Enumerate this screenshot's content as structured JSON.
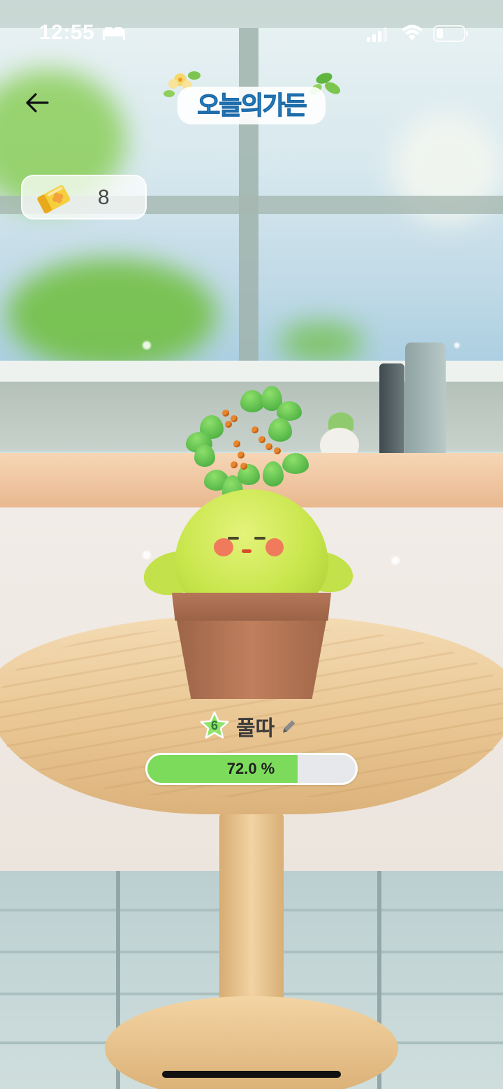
{
  "status_bar": {
    "time": "12:55"
  },
  "header": {
    "title": "오늘의가든",
    "back_icon": "arrow-left-icon"
  },
  "ticket": {
    "count": "8",
    "icon": "ticket-clover-icon"
  },
  "plant": {
    "level": "6",
    "name": "풀따",
    "progress_percent": 72.0,
    "progress_label": "72.0 %"
  },
  "colors": {
    "progress_fill": "#7ddb5c",
    "progress_track": "#e6e8ec",
    "level_star": "#8fe26a"
  }
}
